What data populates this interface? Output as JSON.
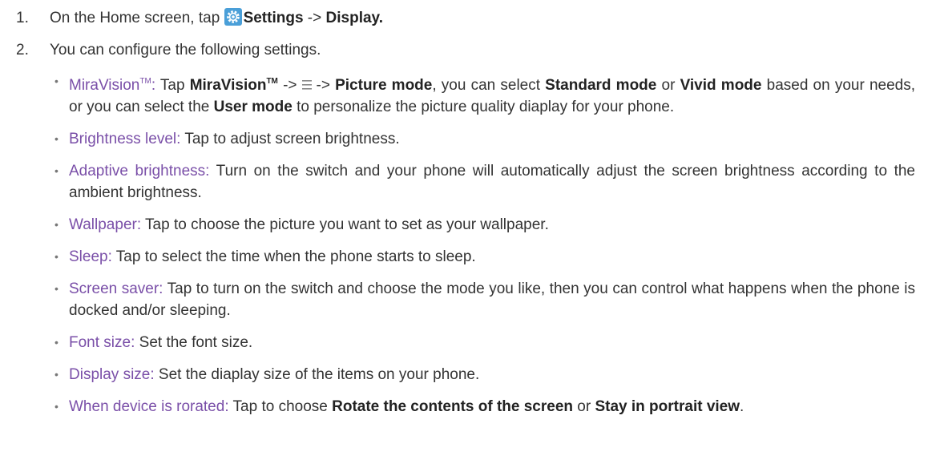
{
  "step1": {
    "number": "1.",
    "prefix": "On the Home screen, tap",
    "settings_label": "Settings",
    "arrow": "->",
    "display_label": "Display."
  },
  "step2": {
    "number": "2.",
    "text": "You can configure the following settings."
  },
  "miravision": {
    "term": "MiraVision",
    "tm": "TM",
    "colon": ":",
    "t1": " Tap ",
    "b1": "MiraVision",
    "b1_tm": "TM",
    "arrow1": "->",
    "arrow2": "->",
    "b2": "Picture mode",
    "t2": ", you can select ",
    "b3": "Standard mode",
    "t3": " or ",
    "b4": "Vivid mode",
    "t4": " based on your needs, or you can select the ",
    "b5": "User mode",
    "t5": " to personalize the picture quality diaplay for your phone."
  },
  "items": [
    {
      "term": "Brightness level:",
      "text": " Tap to adjust screen brightness."
    },
    {
      "term": "Adaptive brightness:",
      "text": " Turn on the switch and your phone will automatically adjust the screen brightness according to the ambient brightness."
    },
    {
      "term": "Wallpaper:",
      "text": " Tap to choose the picture you want to set as your wallpaper."
    },
    {
      "term": "Sleep:",
      "text": " Tap to select the time when the phone starts to sleep."
    },
    {
      "term": "Screen saver:",
      "text": " Tap to turn on the switch and choose the mode you like, then you can control what happens when the phone is docked and/or sleeping."
    },
    {
      "term": "Font size:",
      "text": " Set the font size."
    },
    {
      "term": "Display size:",
      "text": " Set the diaplay size of the items on your phone."
    }
  ],
  "rotated": {
    "term": "When device is rorated:",
    "t1": " Tap to choose ",
    "b1": "Rotate the contents of the screen",
    "t2": " or ",
    "b2": "Stay in portrait view",
    "t3": "."
  },
  "bullet": "•",
  "icons": {
    "settings": "gear-icon",
    "menu": "menu-icon"
  },
  "colors": {
    "term": "#7a4fa8",
    "gear": "#4a9fd8"
  }
}
